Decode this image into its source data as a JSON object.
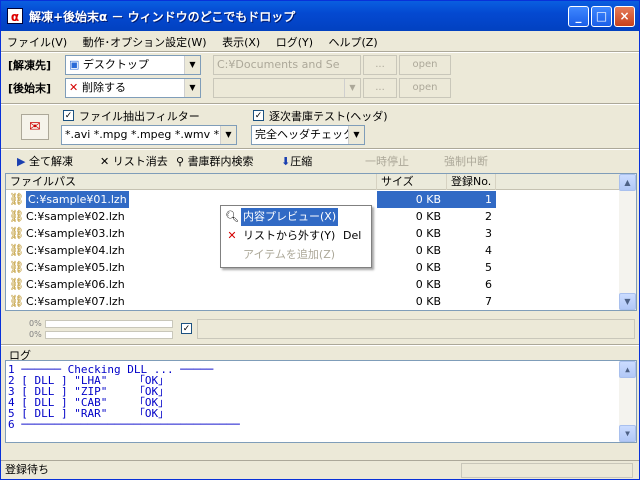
{
  "window": {
    "title": "解凍+後始末α － ウィンドウのどこでもドロップ",
    "app_icon": "α"
  },
  "titlebar_buttons": {
    "minimize": "_",
    "maximize": "□",
    "close": "×"
  },
  "menu": [
    "ファイル(V)",
    "動作･オプション設定(W)",
    "表示(X)",
    "ログ(Y)",
    "ヘルプ(Z)"
  ],
  "dest": {
    "label": "[解凍先]",
    "combo_value": "デスクトップ",
    "path_placeholder": "C:¥Documents and Se",
    "browse": "...",
    "open": "open"
  },
  "after": {
    "label": "[後始末]",
    "combo_value": "削除する",
    "browse": "...",
    "open": "open"
  },
  "filter": {
    "checkbox_label": "ファイル抽出フィルター",
    "checked": true,
    "value": "*.avi *.mpg *.mpeg *.wmv *.rm"
  },
  "header_test": {
    "checkbox_label": "逐次書庫テスト(ヘッダ)",
    "checked": true,
    "value": "完全ヘッダチェック"
  },
  "toolbar": {
    "extract_all": "全て解凍",
    "clear_list": "リスト消去",
    "search": "書庫群内検索",
    "compress": "圧縮",
    "pause": "一時停止",
    "abort": "強制中断"
  },
  "list": {
    "columns": [
      "ファイルパス",
      "サイズ",
      "登録No."
    ],
    "rows": [
      {
        "path": "C:¥sample¥01.lzh",
        "size": "0 KB",
        "no": "1",
        "selected": true
      },
      {
        "path": "C:¥sample¥02.lzh",
        "size": "0 KB",
        "no": "2",
        "selected": false
      },
      {
        "path": "C:¥sample¥03.lzh",
        "size": "0 KB",
        "no": "3",
        "selected": false
      },
      {
        "path": "C:¥sample¥04.lzh",
        "size": "0 KB",
        "no": "4",
        "selected": false
      },
      {
        "path": "C:¥sample¥05.lzh",
        "size": "0 KB",
        "no": "5",
        "selected": false
      },
      {
        "path": "C:¥sample¥06.lzh",
        "size": "0 KB",
        "no": "6",
        "selected": false
      },
      {
        "path": "C:¥sample¥07.lzh",
        "size": "0 KB",
        "no": "7",
        "selected": false
      }
    ]
  },
  "context_menu": [
    {
      "label": "内容プレビュー(X)",
      "shortcut": "",
      "icon": "magnifier-icon",
      "enabled": true,
      "highlighted": true
    },
    {
      "label": "リストから外す(Y)",
      "shortcut": "Del",
      "icon": "red-x-icon",
      "enabled": true,
      "highlighted": false
    },
    {
      "label": "アイテムを追加(Z)",
      "shortcut": "",
      "icon": "",
      "enabled": false,
      "highlighted": false
    }
  ],
  "progress": {
    "top_label": "0%",
    "bottom_label": "0%",
    "top_value": 0,
    "bottom_value": 0,
    "checked": true
  },
  "log": {
    "title": "ログ",
    "lines": [
      "1 ────── Checking DLL ... ─────",
      "2 [ DLL ] \"LHA\"    「OK」",
      "3 [ DLL ] \"ZIP\"    「OK」",
      "4 [ DLL ] \"CAB\"    「OK」",
      "5 [ DLL ] \"RAR\"    「OK」",
      "6 ─────────────────────────────────"
    ]
  },
  "status": {
    "text": "登録待ち"
  },
  "colors": {
    "title_blue": "#0449d1",
    "selection": "#316ac5",
    "log_text": "#0000c8"
  }
}
